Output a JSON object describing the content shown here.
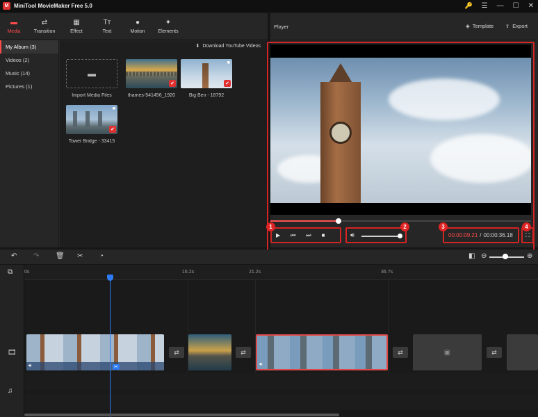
{
  "app": {
    "title": "MiniTool MovieMaker Free 5.0",
    "logo_letter": "M"
  },
  "window_controls": {
    "key": "🔑",
    "menu": "☰",
    "minimize": "—",
    "maximize": "☐",
    "close": "✕"
  },
  "toolbar": {
    "items": [
      {
        "label": "Media",
        "icon": "▬",
        "active": true
      },
      {
        "label": "Transition",
        "icon": "⇄"
      },
      {
        "label": "Effect",
        "icon": "▦"
      },
      {
        "label": "Text",
        "icon": "Tт"
      },
      {
        "label": "Motion",
        "icon": "●"
      },
      {
        "label": "Elements",
        "icon": "✦"
      }
    ]
  },
  "sidebar": {
    "items": [
      {
        "label": "My Album (3)"
      },
      {
        "label": "Videos (2)"
      },
      {
        "label": "Music (14)"
      },
      {
        "label": "Pictures (1)"
      }
    ]
  },
  "media": {
    "download_label": "Download YouTube Videos",
    "import_label": "Import Media Files",
    "items": [
      {
        "name": "thames-541456_1920"
      },
      {
        "name": "Big Ben - 18792"
      },
      {
        "name": "Tower Bridge - 33415"
      }
    ]
  },
  "player": {
    "title": "Player",
    "template_label": "Template",
    "export_label": "Export",
    "current_time": "00:00:09.21",
    "separator": "/",
    "total_time": "00:00:36.18",
    "progress": 0.26,
    "volume": 1.0,
    "badges": [
      "1",
      "2",
      "3",
      "4"
    ]
  },
  "timeline": {
    "ticks": [
      "0s",
      "16.2s",
      "21.2s",
      "36.7s"
    ],
    "zoom_level": 0.45
  }
}
